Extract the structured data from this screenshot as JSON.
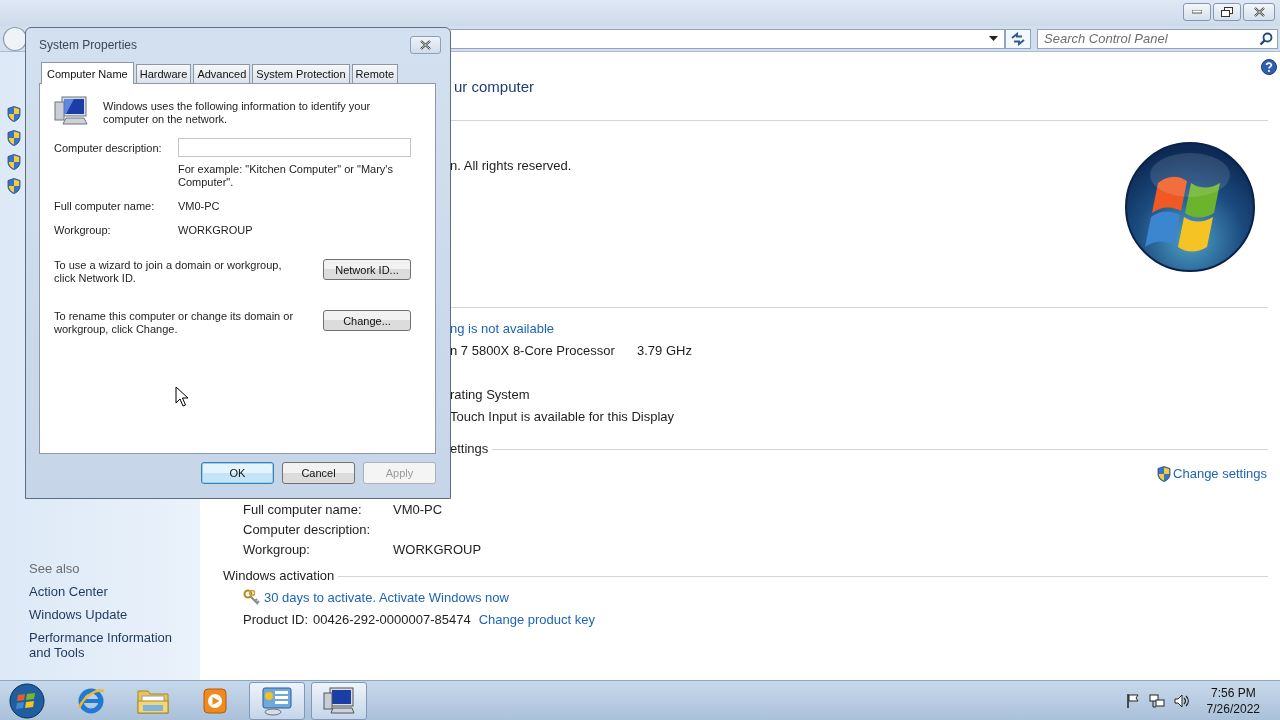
{
  "window": {
    "search": {
      "placeholder": "Search Control Panel"
    }
  },
  "sidebar": {
    "see_also": {
      "heading": "See also",
      "links": [
        "Action Center",
        "Windows Update",
        "Performance Information and Tools"
      ]
    }
  },
  "main": {
    "title": "ur computer",
    "edition_rows": [
      "n.  All rights reserved."
    ],
    "system_rows": [
      {
        "kind": "link",
        "label": "ng is not available"
      },
      {
        "kind": "pair",
        "label": "n 7 5800X 8-Core Processor",
        "value": "3.79 GHz"
      },
      {
        "kind": "text",
        "label": "rating System"
      },
      {
        "kind": "text",
        "label": "Touch Input is available for this Display"
      }
    ],
    "computer_name_section": {
      "heading": "ettings",
      "action": "Change settings",
      "rows": [
        {
          "label": "Full computer name:",
          "value": "VM0-PC"
        },
        {
          "label": "Computer description:"
        },
        {
          "label": "Workgroup:",
          "value": "WORKGROUP"
        }
      ]
    },
    "activation_section": {
      "heading": "Windows activation",
      "status_link": "30 days to activate. Activate Windows now",
      "product_id_label": "Product ID:",
      "product_id": "00426-292-0000007-85474",
      "change_key_link": "Change product key"
    }
  },
  "dialog": {
    "title": "System Properties",
    "tabs": [
      {
        "label": "Computer Name",
        "selected": true
      },
      {
        "label": "Hardware",
        "selected": false
      },
      {
        "label": "Advanced",
        "selected": false
      },
      {
        "label": "System Protection",
        "selected": false
      },
      {
        "label": "Remote",
        "selected": false
      }
    ],
    "intro": "Windows uses the following information to identify your computer on the network.",
    "description_label": "Computer description:",
    "description_hint": "For example: \"Kitchen Computer\" or \"Mary's Computer\".",
    "fields": [
      {
        "label": "Full computer name:",
        "value": "VM0-PC"
      },
      {
        "label": "Workgroup:",
        "value": "WORKGROUP"
      }
    ],
    "actions": [
      {
        "text": "To use a wizard to join a domain or workgroup, click Network ID.",
        "button": "Network ID..."
      },
      {
        "text": "To rename this computer or change its domain or workgroup, click Change.",
        "button": "Change..."
      }
    ],
    "buttons": [
      {
        "label": "OK",
        "default": true,
        "disabled": false
      },
      {
        "label": "Cancel",
        "default": false,
        "disabled": false
      },
      {
        "label": "Apply",
        "default": false,
        "disabled": true
      }
    ]
  },
  "taskbar": {
    "items": [
      {
        "kind": "browser",
        "running": false
      },
      {
        "kind": "folder",
        "running": false
      },
      {
        "kind": "media",
        "running": false
      },
      {
        "kind": "control-panel",
        "running": true
      },
      {
        "kind": "system",
        "running": true
      }
    ],
    "clock": {
      "time": "7:56 PM",
      "date": "7/26/2022"
    }
  }
}
